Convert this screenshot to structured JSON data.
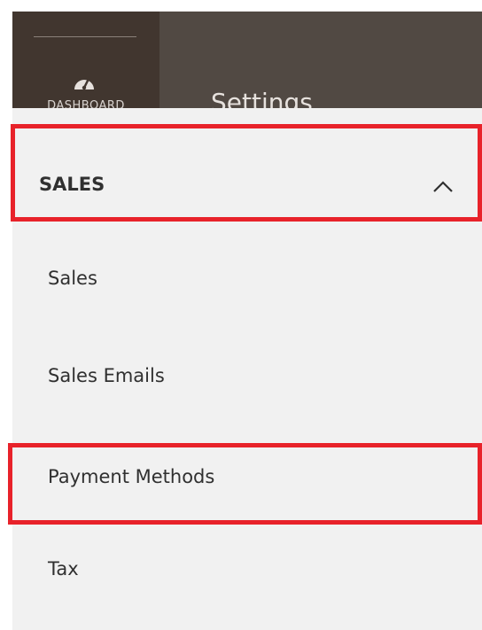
{
  "header": {
    "dashboard_label": "DASHBOARD",
    "page_title": "Settings"
  },
  "menu": {
    "section_title": "SALES",
    "items": [
      {
        "label": "Sales"
      },
      {
        "label": "Sales Emails"
      },
      {
        "label": "Payment Methods"
      },
      {
        "label": "Tax"
      }
    ]
  },
  "colors": {
    "topbar": "#514943",
    "dashboard_tile": "#41362f",
    "menu_background": "#f1f1f1",
    "highlight_border": "#e8222a",
    "text": "#303030"
  },
  "icons": {
    "dashboard": "speedometer-icon",
    "section_toggle": "chevron-up-icon"
  }
}
